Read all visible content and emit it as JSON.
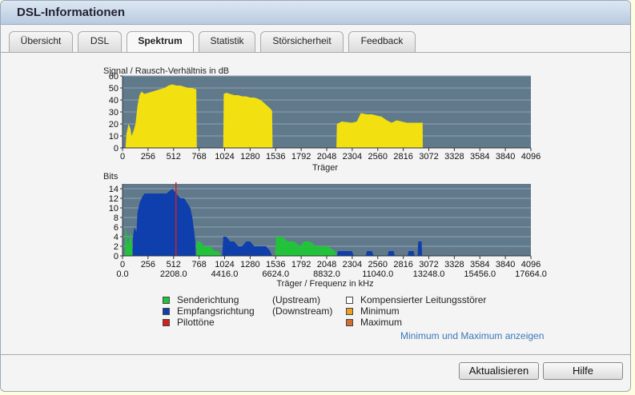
{
  "window": {
    "title": "DSL-Informationen"
  },
  "tabs": [
    {
      "label": "Übersicht"
    },
    {
      "label": "DSL"
    },
    {
      "label": "Spektrum"
    },
    {
      "label": "Statistik"
    },
    {
      "label": "Störsicherheit"
    },
    {
      "label": "Feedback"
    }
  ],
  "active_tab": "Spektrum",
  "chart_data": [
    {
      "type": "area",
      "title": "Signal / Rausch-Verhältnis in dB",
      "xlabel": "Träger",
      "ylabel": "",
      "xlim": [
        0,
        4096
      ],
      "ylim": [
        0,
        60
      ],
      "xticks": [
        "0",
        "256",
        "512",
        "768",
        "1024",
        "1280",
        "1536",
        "1792",
        "2048",
        "2304",
        "2560",
        "2816",
        "3072",
        "3328",
        "3584",
        "3840",
        "4096"
      ],
      "yticks": [
        "0",
        "10",
        "20",
        "30",
        "40",
        "50",
        "60"
      ],
      "grid": true,
      "series": [
        {
          "color": "#f2e010",
          "points": [
            [
              30,
              0
            ],
            [
              40,
              12
            ],
            [
              60,
              20
            ],
            [
              80,
              16
            ],
            [
              90,
              10
            ],
            [
              110,
              14
            ],
            [
              130,
              20
            ],
            [
              150,
              35
            ],
            [
              170,
              44
            ],
            [
              190,
              47
            ],
            [
              220,
              45
            ],
            [
              260,
              46
            ],
            [
              300,
              47
            ],
            [
              340,
              48
            ],
            [
              380,
              49
            ],
            [
              420,
              50
            ],
            [
              460,
              52
            ],
            [
              500,
              53
            ],
            [
              540,
              52
            ],
            [
              580,
              52
            ],
            [
              620,
              51
            ],
            [
              660,
              50
            ],
            [
              700,
              50
            ],
            [
              730,
              49
            ],
            [
              740,
              49
            ],
            [
              745,
              0
            ]
          ]
        },
        {
          "color": "#f2e010",
          "points": [
            [
              1010,
              0
            ],
            [
              1015,
              45
            ],
            [
              1040,
              46
            ],
            [
              1080,
              45
            ],
            [
              1120,
              44
            ],
            [
              1160,
              44
            ],
            [
              1200,
              43
            ],
            [
              1240,
              43
            ],
            [
              1280,
              42
            ],
            [
              1320,
              42
            ],
            [
              1360,
              41
            ],
            [
              1400,
              39
            ],
            [
              1440,
              36
            ],
            [
              1480,
              33
            ],
            [
              1500,
              31
            ],
            [
              1505,
              0
            ]
          ]
        },
        {
          "color": "#f2e010",
          "points": [
            [
              2145,
              0
            ],
            [
              2150,
              20
            ],
            [
              2200,
              22
            ],
            [
              2300,
              21
            ],
            [
              2350,
              22
            ],
            [
              2390,
              29
            ],
            [
              2450,
              28
            ],
            [
              2500,
              28
            ],
            [
              2550,
              27
            ],
            [
              2600,
              26
            ],
            [
              2650,
              23
            ],
            [
              2700,
              21
            ],
            [
              2750,
              23
            ],
            [
              2800,
              22
            ],
            [
              2850,
              21
            ],
            [
              2900,
              21
            ],
            [
              3010,
              21
            ],
            [
              3012,
              0
            ]
          ]
        }
      ]
    },
    {
      "type": "area",
      "title": "Bits",
      "xlabel": "Träger / Frequenz in kHz",
      "ylabel": "",
      "xlim": [
        0,
        4096
      ],
      "ylim": [
        0,
        15
      ],
      "xticks": [
        "0",
        "256",
        "512",
        "768",
        "1024",
        "1280",
        "1536",
        "1792",
        "2048",
        "2304",
        "2560",
        "2816",
        "3072",
        "3328",
        "3584",
        "3840",
        "4096"
      ],
      "x2ticks": [
        "0.0",
        "2208.0",
        "4416.0",
        "6624.0",
        "8832.0",
        "11040.0",
        "13248.0",
        "15456.0",
        "17664.0"
      ],
      "yticks": [
        "0",
        "2",
        "4",
        "6",
        "8",
        "10",
        "12",
        "14"
      ],
      "grid": true,
      "series": [
        {
          "name": "Senderichtung",
          "color": "#22c33a",
          "points": [
            [
              25,
              0
            ],
            [
              30,
              6
            ],
            [
              40,
              5
            ],
            [
              55,
              2
            ],
            [
              70,
              4
            ],
            [
              85,
              5
            ],
            [
              95,
              2
            ],
            [
              100,
              0
            ]
          ]
        },
        {
          "name": "Empfangsrichtung",
          "color": "#0f3fad",
          "points": [
            [
              100,
              0
            ],
            [
              105,
              4
            ],
            [
              120,
              6
            ],
            [
              140,
              5
            ],
            [
              150,
              9
            ],
            [
              170,
              11
            ],
            [
              190,
              12
            ],
            [
              220,
              13
            ],
            [
              260,
              13
            ],
            [
              320,
              13
            ],
            [
              380,
              13
            ],
            [
              440,
              13
            ],
            [
              500,
              14
            ],
            [
              540,
              13
            ],
            [
              580,
              12
            ],
            [
              620,
              12
            ],
            [
              650,
              11
            ],
            [
              680,
              10
            ],
            [
              700,
              8
            ],
            [
              720,
              5
            ],
            [
              730,
              3
            ],
            [
              735,
              0
            ]
          ]
        },
        {
          "name": "Senderichtung",
          "color": "#22c33a",
          "points": [
            [
              740,
              0
            ],
            [
              745,
              3
            ],
            [
              780,
              3
            ],
            [
              820,
              2
            ],
            [
              880,
              2
            ],
            [
              920,
              1
            ],
            [
              960,
              1
            ],
            [
              990,
              0
            ]
          ]
        },
        {
          "name": "Empfangsrichtung",
          "color": "#0f3fad",
          "points": [
            [
              1000,
              0
            ],
            [
              1010,
              4
            ],
            [
              1040,
              4
            ],
            [
              1080,
              3
            ],
            [
              1120,
              3
            ],
            [
              1160,
              2
            ],
            [
              1200,
              2
            ],
            [
              1240,
              3
            ],
            [
              1280,
              3
            ],
            [
              1320,
              2
            ],
            [
              1360,
              2
            ],
            [
              1400,
              2
            ],
            [
              1440,
              2
            ],
            [
              1480,
              1
            ],
            [
              1500,
              0
            ]
          ]
        },
        {
          "name": "Senderichtung",
          "color": "#22c33a",
          "points": [
            [
              1530,
              0
            ],
            [
              1540,
              4
            ],
            [
              1600,
              4
            ],
            [
              1660,
              3
            ],
            [
              1720,
              3
            ],
            [
              1780,
              2
            ],
            [
              1820,
              3
            ],
            [
              1880,
              3
            ],
            [
              1940,
              2
            ],
            [
              2000,
              2
            ],
            [
              2060,
              2
            ],
            [
              2130,
              1
            ],
            [
              2150,
              0
            ]
          ]
        },
        {
          "name": "Empfangsrichtung",
          "color": "#0f3fad",
          "points": [
            [
              2150,
              0
            ],
            [
              2160,
              1
            ],
            [
              2200,
              1
            ],
            [
              2250,
              1
            ],
            [
              2300,
              1
            ],
            [
              2320,
              0
            ]
          ]
        },
        {
          "name": "Empfangsrichtung",
          "color": "#0f3fad",
          "points": [
            [
              2440,
              0
            ],
            [
              2450,
              1
            ],
            [
              2500,
              1
            ],
            [
              2520,
              0
            ],
            [
              2660,
              0
            ],
            [
              2670,
              1
            ],
            [
              2720,
              1
            ],
            [
              2730,
              0
            ],
            [
              2860,
              0
            ],
            [
              2870,
              1
            ],
            [
              2920,
              1
            ],
            [
              2930,
              0
            ]
          ]
        },
        {
          "name": "Empfangsrichtung",
          "color": "#0f3fad",
          "points": [
            [
              2960,
              0
            ],
            [
              2965,
              3
            ],
            [
              3000,
              3
            ],
            [
              3005,
              0
            ]
          ]
        }
      ],
      "pilot": {
        "name": "Pilottöne",
        "color": "#d02020",
        "x": 536
      }
    }
  ],
  "legend": [
    {
      "label": "Senderichtung",
      "note": "(Upstream)",
      "color": "#22c33a"
    },
    {
      "label": "Empfangsrichtung",
      "note": "(Downstream)",
      "color": "#0f3fad"
    },
    {
      "label": "Pilottöne",
      "note": "",
      "color": "#d02020"
    },
    {
      "label": "Kompensierter Leitungsstörer",
      "color": "#ffffff"
    },
    {
      "label": "Minimum",
      "color": "#f0a020"
    },
    {
      "label": "Maximum",
      "color": "#d07030"
    }
  ],
  "link_min_max": "Minimum und Maximum anzeigen",
  "buttons": {
    "refresh": "Aktualisieren",
    "help": "Hilfe"
  }
}
